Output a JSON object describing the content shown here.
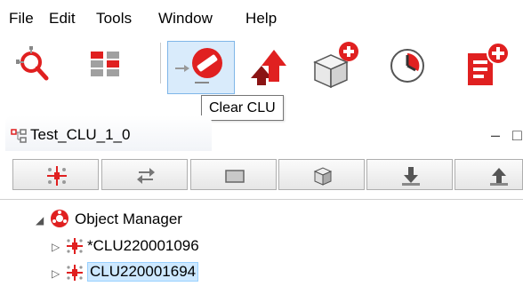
{
  "menu": {
    "items": [
      "File",
      "Edit",
      "Tools",
      "Window",
      "Help"
    ]
  },
  "toolbar": {
    "buttons": [
      {
        "icon": "search-network-icon"
      },
      {
        "icon": "layout-grid-icon"
      },
      {
        "icon": "clear-clu-icon",
        "pressed": true
      },
      {
        "icon": "upload-arrows-icon"
      },
      {
        "icon": "add-box-icon"
      },
      {
        "icon": "clock-icon"
      },
      {
        "icon": "add-document-icon"
      }
    ],
    "tooltip": "Clear CLU"
  },
  "tab": {
    "label": "Test_CLU_1_0",
    "icon": "clu-tree-icon"
  },
  "view_toolbar": {
    "buttons": [
      "network-icon",
      "swap-arrows-icon",
      "rectangle-icon",
      "cube-icon",
      "download-icon",
      "upload-icon"
    ]
  },
  "tree": {
    "root": {
      "label": "Object Manager",
      "icon": "object-manager-icon",
      "expanded": true
    },
    "children": [
      {
        "label": "*CLU220001096",
        "icon": "clu-node-icon",
        "selected": false
      },
      {
        "label": "CLU220001694",
        "icon": "clu-node-icon",
        "selected": true
      }
    ]
  },
  "colors": {
    "accent_red": "#e02020",
    "selection": "#cde8ff",
    "pressed": "#d9ebfb"
  }
}
